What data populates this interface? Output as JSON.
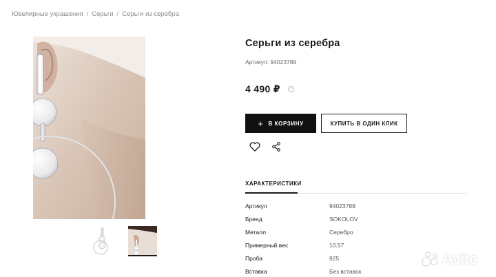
{
  "breadcrumb": {
    "items": [
      "Ювелирные украшения",
      "Серьги",
      "Серьги из серебра"
    ],
    "separator": "/"
  },
  "product": {
    "title": "Серьги из серебра",
    "sku_line": "Артикул: 94023789",
    "price": "4 490 ₽",
    "info_glyph": "i"
  },
  "actions": {
    "cart_plus": "+",
    "cart_label": "В КОРЗИНУ",
    "one_click_label": "КУПИТЬ В ОДИН КЛИК",
    "favorite_icon": "heart-icon",
    "share_icon": "share-icon"
  },
  "specs": {
    "tab_label": "ХАРАКТЕРИСТИКИ",
    "rows": [
      {
        "key": "Артикул",
        "value": "94023789"
      },
      {
        "key": "Бренд",
        "value": "SOKOLOV"
      },
      {
        "key": "Металл",
        "value": "Серебро"
      },
      {
        "key": "Примерный вес",
        "value": "10.57"
      },
      {
        "key": "Проба",
        "value": "925"
      },
      {
        "key": "Вставка",
        "value": "Без вставок"
      }
    ]
  },
  "gallery": {
    "active_thumb": 2,
    "thumb_count": 2
  },
  "watermark": {
    "text": "Avito"
  },
  "colors": {
    "primary_button": "#111111",
    "background": "#ffffff",
    "muted_text": "#8a8a8a"
  }
}
